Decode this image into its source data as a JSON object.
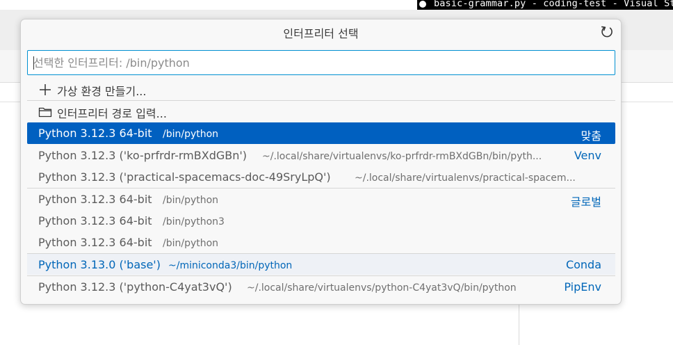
{
  "window": {
    "title": "basic-grammar.py - coding-test - Visual Stu"
  },
  "quick_pick": {
    "title": "인터프리터 선택",
    "refresh_icon": "refresh-icon",
    "input": {
      "value": "",
      "placeholder": "선택한 인터프리터: /bin/python"
    },
    "actions": [
      {
        "icon": "add-icon",
        "label": "가상 환경 만들기..."
      },
      {
        "icon": "folder-icon",
        "label": "인터프리터 경로 입력..."
      }
    ],
    "items": [
      {
        "label": "Python 3.12.3 64-bit",
        "description": "/bin/python",
        "tag": "맞춤",
        "selected": true
      },
      {
        "label": "Python 3.12.3 ('ko-prfrdr-rmBXdGBn')",
        "description": "~/.local/share/virtualenvs/ko-prfrdr-rmBXdGBn/bin/pyth...",
        "tag": "Venv"
      },
      {
        "label": "Python 3.12.3 ('practical-spacemacs-doc-49SryLpQ')",
        "description": "~/.local/share/virtualenvs/practical-spacem...",
        "tag": ""
      },
      {
        "label": "Python 3.12.3 64-bit",
        "description": "/bin/python",
        "tag": "글로벌"
      },
      {
        "label": "Python 3.12.3 64-bit",
        "description": "/bin/python3",
        "tag": ""
      },
      {
        "label": "Python 3.12.3 64-bit",
        "description": "/bin/python",
        "tag": ""
      },
      {
        "label": "Python 3.13.0 ('base')",
        "description": "~/miniconda3/bin/python",
        "tag": "Conda",
        "highlighted": true
      },
      {
        "label": "Python 3.12.3 ('python-C4yat3vQ')",
        "description": "~/.local/share/virtualenvs/python-C4yat3vQ/bin/python",
        "tag": "PipEnv"
      }
    ]
  },
  "colors": {
    "selection": "#0060c0",
    "accent_text": "#0066b8",
    "focus_border": "#0090d1"
  }
}
